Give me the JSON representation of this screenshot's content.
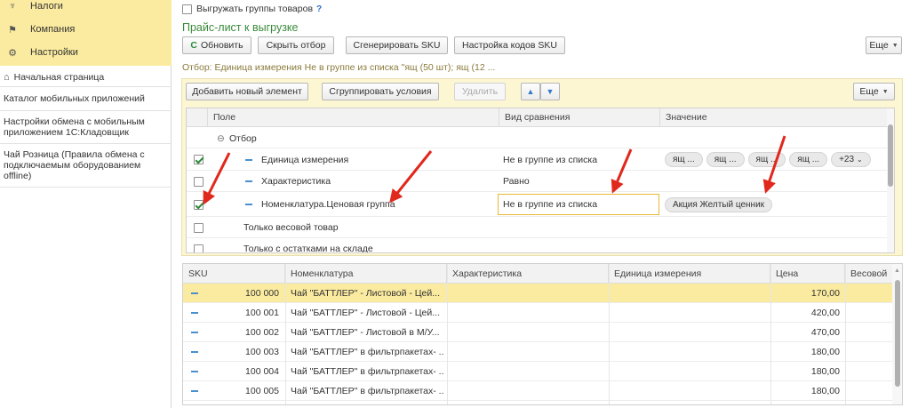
{
  "sidebar": {
    "sections": [
      {
        "label": "Налоги",
        "icon": "taxes-icon"
      },
      {
        "label": "Компания",
        "icon": "flag-icon"
      },
      {
        "label": "Настройки",
        "icon": "gear-icon"
      }
    ],
    "home": "Начальная страница",
    "items": [
      "Каталог мобильных приложений",
      "Настройки обмена с мобильным приложением 1С:Кладовщик",
      "Чай Розница (Правила обмена с подключаемым оборудованием offline)"
    ]
  },
  "top": {
    "export_groups_label": "Выгружать группы товаров",
    "help": "?"
  },
  "section_title": "Прайс-лист к выгрузке",
  "toolbar": {
    "refresh": "Обновить",
    "hide_filter": "Скрыть отбор",
    "generate_sku": "Сгенерировать SKU",
    "sku_settings": "Настройка кодов SKU",
    "more": "Еще"
  },
  "filter_summary": "Отбор: Единица измерения Не в группе из списка \"ящ (50 шт); ящ (12 ...",
  "filter_toolbar": {
    "add_element": "Добавить новый элемент",
    "group_conditions": "Сгруппировать условия",
    "delete": "Удалить",
    "more": "Еще"
  },
  "filter_table": {
    "headers": [
      "Поле",
      "Вид сравнения",
      "Значение"
    ],
    "group_label": "Отбор",
    "rows": [
      {
        "checked": true,
        "field": "Единица измерения",
        "comparison": "Не в группе из списка",
        "values": [
          "ящ ...",
          "ящ ...",
          "ящ ...",
          "ящ ..."
        ],
        "more": "+23"
      },
      {
        "checked": false,
        "field": "Характеристика",
        "comparison": "Равно",
        "values": [],
        "more": ""
      },
      {
        "checked": true,
        "field": "Номенклатура.Ценовая группа",
        "comparison": "Не в группе из списка",
        "values": [
          "Акция Желтый ценник"
        ],
        "more": ""
      }
    ],
    "extra_rows": [
      "Только весовой товар",
      "Только с остатками на складе"
    ]
  },
  "data_table": {
    "headers": [
      "SKU",
      "Номенклатура",
      "Характеристика",
      "Единица измерения",
      "Цена",
      "Весовой"
    ],
    "rows": [
      {
        "sku": "100 000",
        "name": "Чай \"БАТТЛЕР\" - Листовой - Цей...",
        "char": "",
        "unit": "",
        "price": "170,00"
      },
      {
        "sku": "100 001",
        "name": "Чай \"БАТТЛЕР\" - Листовой - Цей...",
        "char": "",
        "unit": "",
        "price": "420,00"
      },
      {
        "sku": "100 002",
        "name": "Чай \"БАТТЛЕР\" - Листовой  в М/У...",
        "char": "",
        "unit": "",
        "price": "470,00"
      },
      {
        "sku": "100 003",
        "name": "Чай \"БАТТЛЕР\" в фильтрпакетах- ...",
        "char": "",
        "unit": "",
        "price": "180,00"
      },
      {
        "sku": "100 004",
        "name": "Чай \"БАТТЛЕР\" в фильтрпакетах- ...",
        "char": "",
        "unit": "",
        "price": "180,00"
      },
      {
        "sku": "100 005",
        "name": "Чай \"БАТТЛЕР\" в фильтрпакетах- ...",
        "char": "",
        "unit": "",
        "price": "180,00"
      }
    ]
  },
  "colors": {
    "accent_green": "#2a8a3a",
    "highlight_yellow": "#fbeba0",
    "title_green": "#3a8a3a",
    "arrow_red": "#e0281c"
  }
}
